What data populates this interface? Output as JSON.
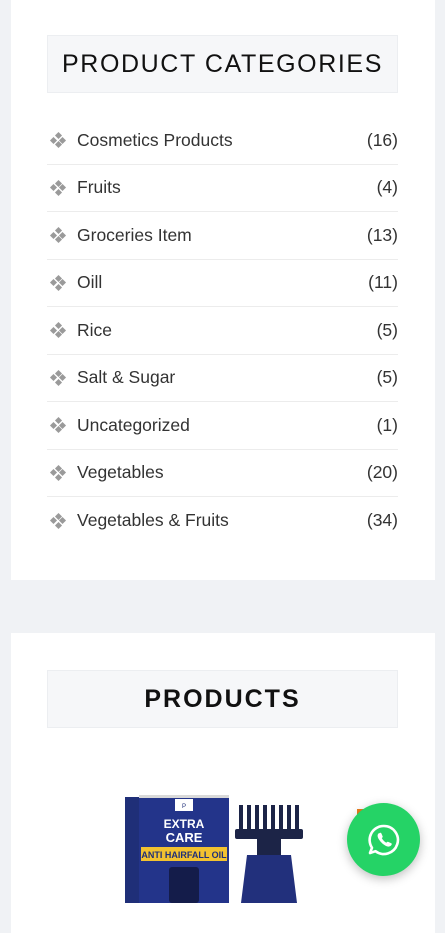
{
  "categories_widget": {
    "title": "PRODUCT CATEGORIES",
    "items": [
      {
        "name": "Cosmetics Products",
        "count": "(16)"
      },
      {
        "name": "Fruits",
        "count": "(4)"
      },
      {
        "name": "Groceries Item",
        "count": "(13)"
      },
      {
        "name": "Oill",
        "count": "(11)"
      },
      {
        "name": "Rice",
        "count": "(5)"
      },
      {
        "name": "Salt & Sugar",
        "count": "(5)"
      },
      {
        "name": "Uncategorized",
        "count": "(1)"
      },
      {
        "name": "Vegetables",
        "count": "(20)"
      },
      {
        "name": "Vegetables & Fruits",
        "count": "(34)"
      }
    ]
  },
  "products_widget": {
    "title": "PRODUCTS",
    "product_image_text": {
      "brand_line1": "EXTRA",
      "brand_line2": "CARE",
      "product_line": "ANTI HAIRFALL OIL"
    }
  },
  "floating_button": {
    "icon": "whatsapp-icon",
    "color": "#25d366"
  }
}
